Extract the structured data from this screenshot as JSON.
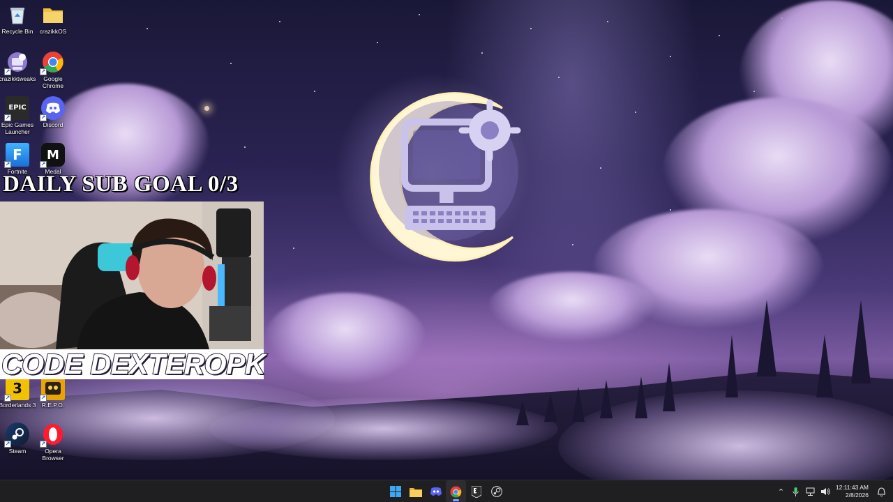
{
  "desktop": {
    "icons": [
      {
        "label": "Recycle Bin",
        "icon": "recycle-bin-icon"
      },
      {
        "label": "crazikkOS",
        "icon": "folder-icon"
      },
      {
        "label": "crazikktweaks",
        "icon": "tweaks-app-icon"
      },
      {
        "label": "Google Chrome",
        "icon": "chrome-icon"
      },
      {
        "label": "Epic Games Launcher",
        "icon": "epic-games-icon",
        "glyph": "EPIC"
      },
      {
        "label": "Discord",
        "icon": "discord-icon"
      },
      {
        "label": "Fortnite",
        "icon": "fortnite-icon",
        "glyph": "F"
      },
      {
        "label": "Medal",
        "icon": "medal-icon",
        "glyph": "M"
      },
      {
        "label": "Borderlands 3",
        "icon": "borderlands-icon",
        "glyph": "3"
      },
      {
        "label": "R.E.P.O.",
        "icon": "repo-icon"
      },
      {
        "label": "Steam",
        "icon": "steam-icon"
      },
      {
        "label": "Opera Browser",
        "icon": "opera-icon"
      }
    ]
  },
  "overlay": {
    "sub_goal": "DAILY SUB GOAL 0/3",
    "code_banner": "CODE DEXTEROPK"
  },
  "taskbar": {
    "apps": [
      {
        "name": "start",
        "icon": "windows-start-icon"
      },
      {
        "name": "file-explorer",
        "icon": "file-explorer-icon"
      },
      {
        "name": "discord",
        "icon": "discord-icon"
      },
      {
        "name": "chrome",
        "icon": "chrome-icon",
        "active": true
      },
      {
        "name": "epic-games",
        "icon": "epic-games-icon"
      },
      {
        "name": "steam",
        "icon": "steam-icon"
      }
    ],
    "clock": {
      "time": "12:11:43 AM",
      "date": "2/8/2026"
    }
  },
  "colors": {
    "taskbar_bg": "#1f1f22",
    "accent": "#7aa7ff",
    "chrome_red": "#ea4335",
    "discord_blurple": "#5865f2"
  }
}
